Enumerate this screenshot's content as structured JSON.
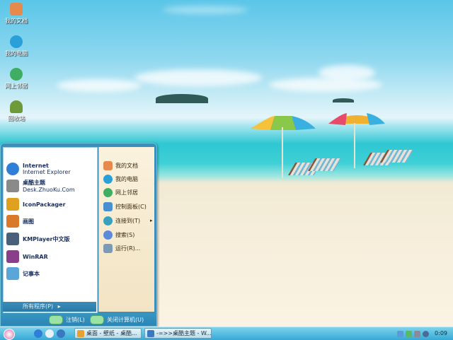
{
  "desktop": {
    "icons": [
      {
        "label": "我的文档",
        "icon": "documents-folder-icon",
        "color": "#e58a4c"
      },
      {
        "label": "我的电脑",
        "icon": "computer-icon",
        "color": "#2aa0d8"
      },
      {
        "label": "网上邻居",
        "icon": "network-globe-icon",
        "color": "#3fae63"
      },
      {
        "label": "回收站",
        "icon": "recycle-bin-plant-icon",
        "color": "#6f9a3a"
      }
    ]
  },
  "start_menu": {
    "pinned": [
      {
        "title": "Internet",
        "subtitle": "Internet Explorer",
        "icon": "ie-icon",
        "color": "#2f7fd8"
      },
      {
        "title": "桌酷主题",
        "subtitle": "Desk.ZhuoKu.Com",
        "icon": "zhuoku-icon",
        "color": "#8a8a8a"
      }
    ],
    "recent": [
      {
        "label": "IconPackager",
        "icon": "iconpackager-icon",
        "color": "#e0a020"
      },
      {
        "label": "画图",
        "icon": "paint-icon",
        "color": "#d97a2a"
      },
      {
        "label": "KMPlayer中文版",
        "icon": "kmplayer-icon",
        "color": "#4a5f7a"
      },
      {
        "label": "WinRAR",
        "icon": "winrar-icon",
        "color": "#8a3f8a"
      },
      {
        "label": "记事本",
        "icon": "notepad-icon",
        "color": "#5aa6d8"
      }
    ],
    "all_programs": "所有程序(P)",
    "right": [
      {
        "label": "我的文档",
        "icon": "documents-folder-icon",
        "color": "#e58a4c"
      },
      {
        "label": "我的电脑",
        "icon": "computer-icon",
        "color": "#2aa0d8"
      },
      {
        "label": "网上邻居",
        "icon": "network-globe-icon",
        "color": "#3fae63"
      },
      {
        "label": "控制面板(C)",
        "icon": "control-panel-icon",
        "color": "#4a8fd0"
      },
      {
        "label": "连接到(T)",
        "icon": "connect-globe-icon",
        "color": "#3aa0c0"
      },
      {
        "label": "搜索(S)",
        "icon": "search-icon",
        "color": "#5a8ad8"
      },
      {
        "label": "运行(R)...",
        "icon": "run-icon",
        "color": "#7a9ab8"
      }
    ],
    "footer": {
      "logoff": "注销(L)",
      "shutdown": "关闭计算机(U)"
    }
  },
  "taskbar": {
    "tasks": [
      {
        "label": "桌面 - 壁纸 - 桌酷...",
        "icon": "browser-icon",
        "color": "#e8a030"
      },
      {
        "label": "-=>>桌酷主题 - W...",
        "icon": "window-icon",
        "color": "#3a78c0"
      }
    ],
    "clock": "0:09"
  }
}
